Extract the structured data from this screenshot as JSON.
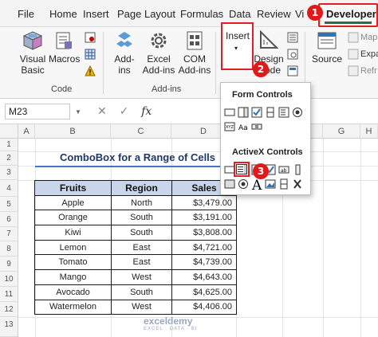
{
  "tabs": [
    "File",
    "Home",
    "Insert",
    "Page Layout",
    "Formulas",
    "Data",
    "Review",
    "Vi"
  ],
  "active_tab": "Developer",
  "step_badges": [
    "1",
    "2",
    "3"
  ],
  "ribbon": {
    "code": {
      "visual_basic": "Visual Basic",
      "macros": "Macros",
      "label": "Code"
    },
    "addins": {
      "addins": "Add-ins",
      "excel_addins": "Excel Add-ins",
      "com_addins": "COM Add-ins",
      "label": "Add-ins"
    },
    "controls": {
      "insert": "Insert",
      "design_mode": "Design Mode"
    },
    "xml": {
      "source": "Source",
      "map": "Map",
      "expa": "Expa",
      "refr": "Refr"
    }
  },
  "formula_bar": {
    "name_box": "M23",
    "cancel": "✕",
    "enter": "✓",
    "fx": "fx"
  },
  "columns": [
    "A",
    "B",
    "C",
    "D",
    "E",
    "F",
    "G",
    "H"
  ],
  "rows": [
    "1",
    "2",
    "3",
    "4",
    "5",
    "6",
    "7",
    "8",
    "9",
    "10",
    "11",
    "12",
    "13"
  ],
  "sheet_title": "ComboBox for a Range of Cells",
  "table": {
    "headers": [
      "Fruits",
      "Region",
      "Sales"
    ],
    "rows": [
      [
        "Apple",
        "North",
        "$3,479.00"
      ],
      [
        "Orange",
        "South",
        "$3,191.00"
      ],
      [
        "Kiwi",
        "South",
        "$3,808.00"
      ],
      [
        "Lemon",
        "East",
        "$4,721.00"
      ],
      [
        "Tomato",
        "East",
        "$4,739.00"
      ],
      [
        "Mango",
        "West",
        "$4,643.00"
      ],
      [
        "Avocado",
        "South",
        "$4,625.00"
      ],
      [
        "Watermelon",
        "West",
        "$4,406.00"
      ]
    ]
  },
  "dropdown": {
    "form_controls": "Form Controls",
    "activex_controls": "ActiveX Controls"
  },
  "watermark": {
    "name": "exceldemy",
    "tagline": "EXCEL · DATA · BI"
  },
  "colors": {
    "accent_red": "#e02020",
    "excel_green": "#217346",
    "header_fill": "#c9d5ea",
    "title_blue": "#1f3864"
  }
}
